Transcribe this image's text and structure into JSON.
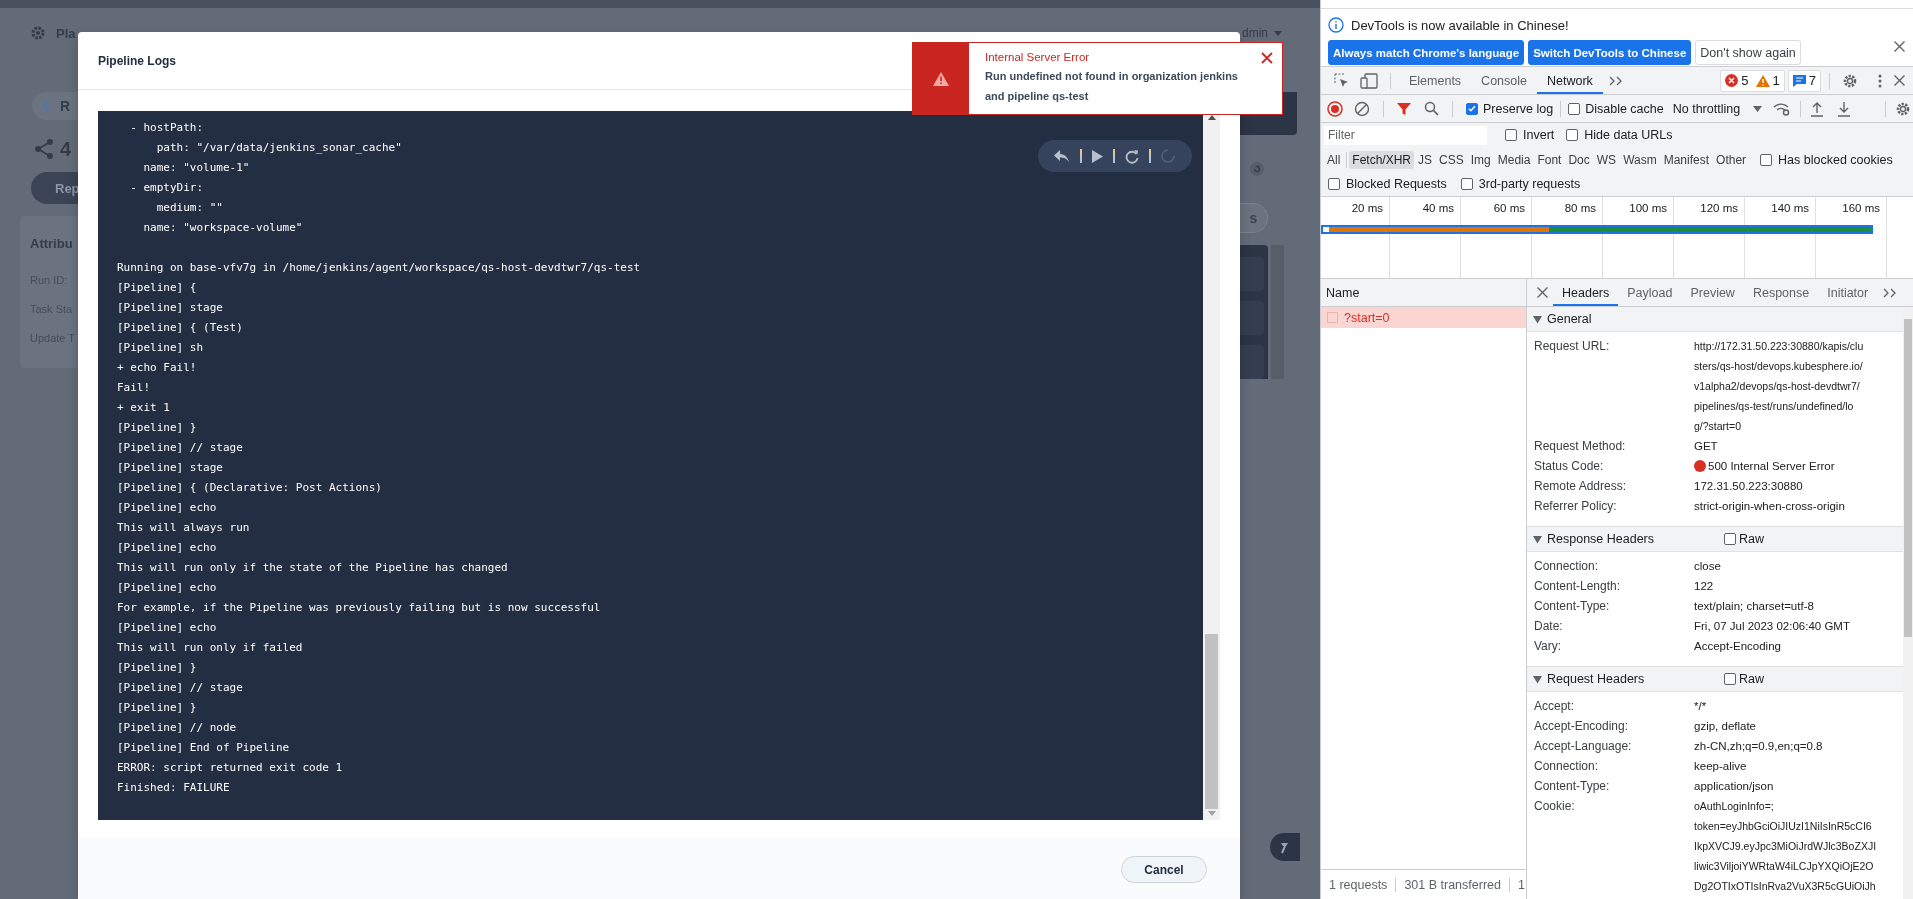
{
  "background_page": {
    "app_title": "Pla",
    "user": "dmin",
    "back_link": "R",
    "heading": "4",
    "action_button": "Rep",
    "side_button": "s",
    "attributes": {
      "title": "Attribu",
      "labels": [
        "Run ID:",
        "Task Sta",
        "Update T"
      ]
    }
  },
  "log_dialog": {
    "title": "Pipeline Logs",
    "log_blocks": [
      [
        "  - hostPath:",
        "      path: \"/var/data/jenkins_sonar_cache\"",
        "    name: \"volume-1\"",
        "  - emptyDir:",
        "      medium: \"\"",
        "    name: \"workspace-volume\""
      ],
      [
        "Running on base-vfv7g in /home/jenkins/agent/workspace/qs-host-devdtwr7/qs-test",
        "[Pipeline] {",
        "[Pipeline] stage",
        "[Pipeline] { (Test)",
        "[Pipeline] sh",
        "+ echo Fail!",
        "Fail!",
        "+ exit 1",
        "[Pipeline] }",
        "[Pipeline] // stage",
        "[Pipeline] stage",
        "[Pipeline] { (Declarative: Post Actions)",
        "[Pipeline] echo",
        "This will always run",
        "[Pipeline] echo",
        "This will run only if the state of the Pipeline has changed",
        "[Pipeline] echo",
        "For example, if the Pipeline was previously failing but is now successful",
        "[Pipeline] echo",
        "This will run only if failed",
        "[Pipeline] }",
        "[Pipeline] // stage",
        "[Pipeline] }",
        "[Pipeline] // node",
        "[Pipeline] End of Pipeline",
        "ERROR: script returned exit code 1",
        "Finished: FAILURE"
      ]
    ],
    "cancel_button": "Cancel"
  },
  "error_toast": {
    "title": "Internal Server Error",
    "message": "Run undefined not found in organization jenkins and pipeline qs-test"
  },
  "devtools": {
    "infobar": {
      "message": "DevTools is now available in Chinese!",
      "buttons": [
        {
          "label": "Always match Chrome's language",
          "kind": "primary"
        },
        {
          "label": "Switch DevTools to Chinese",
          "kind": "primary"
        },
        {
          "label": "Don't show again",
          "kind": "secondary"
        }
      ]
    },
    "tabs": [
      {
        "label": "Elements",
        "selected": false
      },
      {
        "label": "Console",
        "selected": false
      },
      {
        "label": "Network",
        "selected": true
      }
    ],
    "issue_counts": {
      "errors": "5",
      "warnings": "1",
      "messages": "7"
    },
    "network_toolbar": {
      "options": [
        {
          "label": "Preserve log",
          "checked": true
        },
        {
          "label": "Disable cache",
          "checked": false
        }
      ],
      "throttling": "No throttling"
    },
    "filter": {
      "placeholder": "Filter",
      "options": [
        {
          "label": "Invert",
          "checked": false
        },
        {
          "label": "Hide data URLs",
          "checked": false
        }
      ]
    },
    "type_filters": [
      {
        "label": "All",
        "selected": false
      },
      {
        "label": "Fetch/XHR",
        "selected": true
      },
      {
        "label": "JS",
        "selected": false
      },
      {
        "label": "CSS",
        "selected": false
      },
      {
        "label": "Img",
        "selected": false
      },
      {
        "label": "Media",
        "selected": false
      },
      {
        "label": "Font",
        "selected": false
      },
      {
        "label": "Doc",
        "selected": false
      },
      {
        "label": "WS",
        "selected": false
      },
      {
        "label": "Wasm",
        "selected": false
      },
      {
        "label": "Manifest",
        "selected": false
      },
      {
        "label": "Other",
        "selected": false
      }
    ],
    "type_row_options": [
      {
        "label": "Has blocked cookies",
        "checked": false
      }
    ],
    "blocked_options": [
      {
        "label": "Blocked Requests",
        "checked": false
      },
      {
        "label": "3rd-party requests",
        "checked": false
      }
    ],
    "timeline": {
      "ticks": [
        "20 ms",
        "40 ms",
        "60 ms",
        "80 ms",
        "100 ms",
        "120 ms",
        "140 ms",
        "160 ms"
      ]
    },
    "request_list": {
      "column": "Name",
      "requests": [
        {
          "name": "?start=0",
          "selected": true,
          "failed": true
        }
      ]
    },
    "detail_tabs": [
      {
        "label": "Headers",
        "selected": true
      },
      {
        "label": "Payload",
        "selected": false
      },
      {
        "label": "Preview",
        "selected": false
      },
      {
        "label": "Response",
        "selected": false
      },
      {
        "label": "Initiator",
        "selected": false
      }
    ],
    "sections": [
      {
        "title": "General",
        "expanded": true,
        "rows": [
          {
            "kind": "lines",
            "label": "Request URL:",
            "value_lines": [
              "http://172.31.50.223:30880/kapis/clu",
              "sters/qs-host/devops.kubesphere.io/",
              "v1alpha2/devops/qs-host-devdtwr7/",
              "pipelines/qs-test/runs/undefined/lo",
              "g/?start=0"
            ]
          },
          {
            "kind": "text",
            "label": "Request Method:",
            "value": "GET"
          },
          {
            "kind": "status",
            "label": "Status Code:",
            "value": "500 Internal Server Error",
            "color": "#d93025"
          },
          {
            "kind": "text",
            "label": "Remote Address:",
            "value": "172.31.50.223:30880"
          },
          {
            "kind": "text",
            "label": "Referrer Policy:",
            "value": "strict-origin-when-cross-origin"
          }
        ]
      },
      {
        "title": "Response Headers",
        "expanded": true,
        "raw": {
          "label": "Raw",
          "checked": false
        },
        "rows": [
          {
            "kind": "text",
            "label": "Connection:",
            "value": "close"
          },
          {
            "kind": "text",
            "label": "Content-Length:",
            "value": "122"
          },
          {
            "kind": "text",
            "label": "Content-Type:",
            "value": "text/plain; charset=utf-8"
          },
          {
            "kind": "text",
            "label": "Date:",
            "value": "Fri, 07 Jul 2023 02:06:40 GMT"
          },
          {
            "kind": "text",
            "label": "Vary:",
            "value": "Accept-Encoding"
          }
        ]
      },
      {
        "title": "Request Headers",
        "expanded": true,
        "raw": {
          "label": "Raw",
          "checked": false
        },
        "rows": [
          {
            "kind": "text",
            "label": "Accept:",
            "value": "*/*"
          },
          {
            "kind": "text",
            "label": "Accept-Encoding:",
            "value": "gzip, deflate"
          },
          {
            "kind": "text",
            "label": "Accept-Language:",
            "value": "zh-CN,zh;q=0.9,en;q=0.8"
          },
          {
            "kind": "text",
            "label": "Connection:",
            "value": "keep-alive"
          },
          {
            "kind": "text",
            "label": "Content-Type:",
            "value": "application/json"
          },
          {
            "kind": "lines",
            "label": "Cookie:",
            "value_lines": [
              "oAuthLoginInfo=;",
              "token=eyJhbGciOiJIUzI1NiIsInR5cCI6",
              "IkpXVCJ9.eyJpc3MiOiJrdWJlc3BoZXJI",
              "liwic3ViljoiYWRtaW4iLCJpYXQiOjE2O",
              "Dg2OTIxOTIsInRva2VuX3R5cGUiOiJh"
            ]
          }
        ]
      }
    ],
    "status_bar": [
      "1 requests",
      "301 B transferred",
      "1"
    ]
  }
}
